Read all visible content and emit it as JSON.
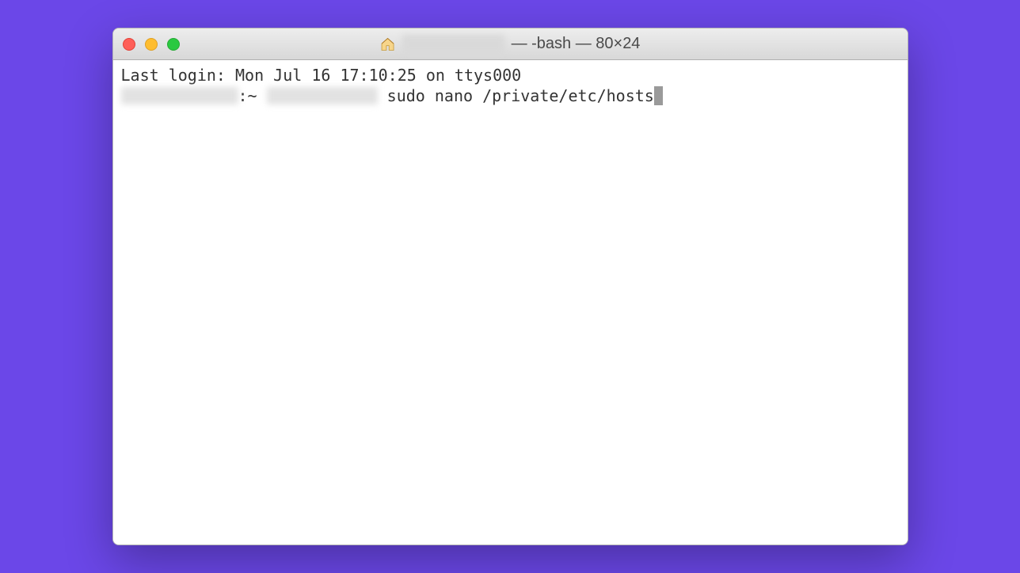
{
  "window": {
    "title_suffix": " — -bash — 80×24"
  },
  "terminal": {
    "last_login": "Last login: Mon Jul 16 17:10:25 on ttys000",
    "prompt_mid": ":~ ",
    "command": " sudo nano /private/etc/hosts"
  }
}
